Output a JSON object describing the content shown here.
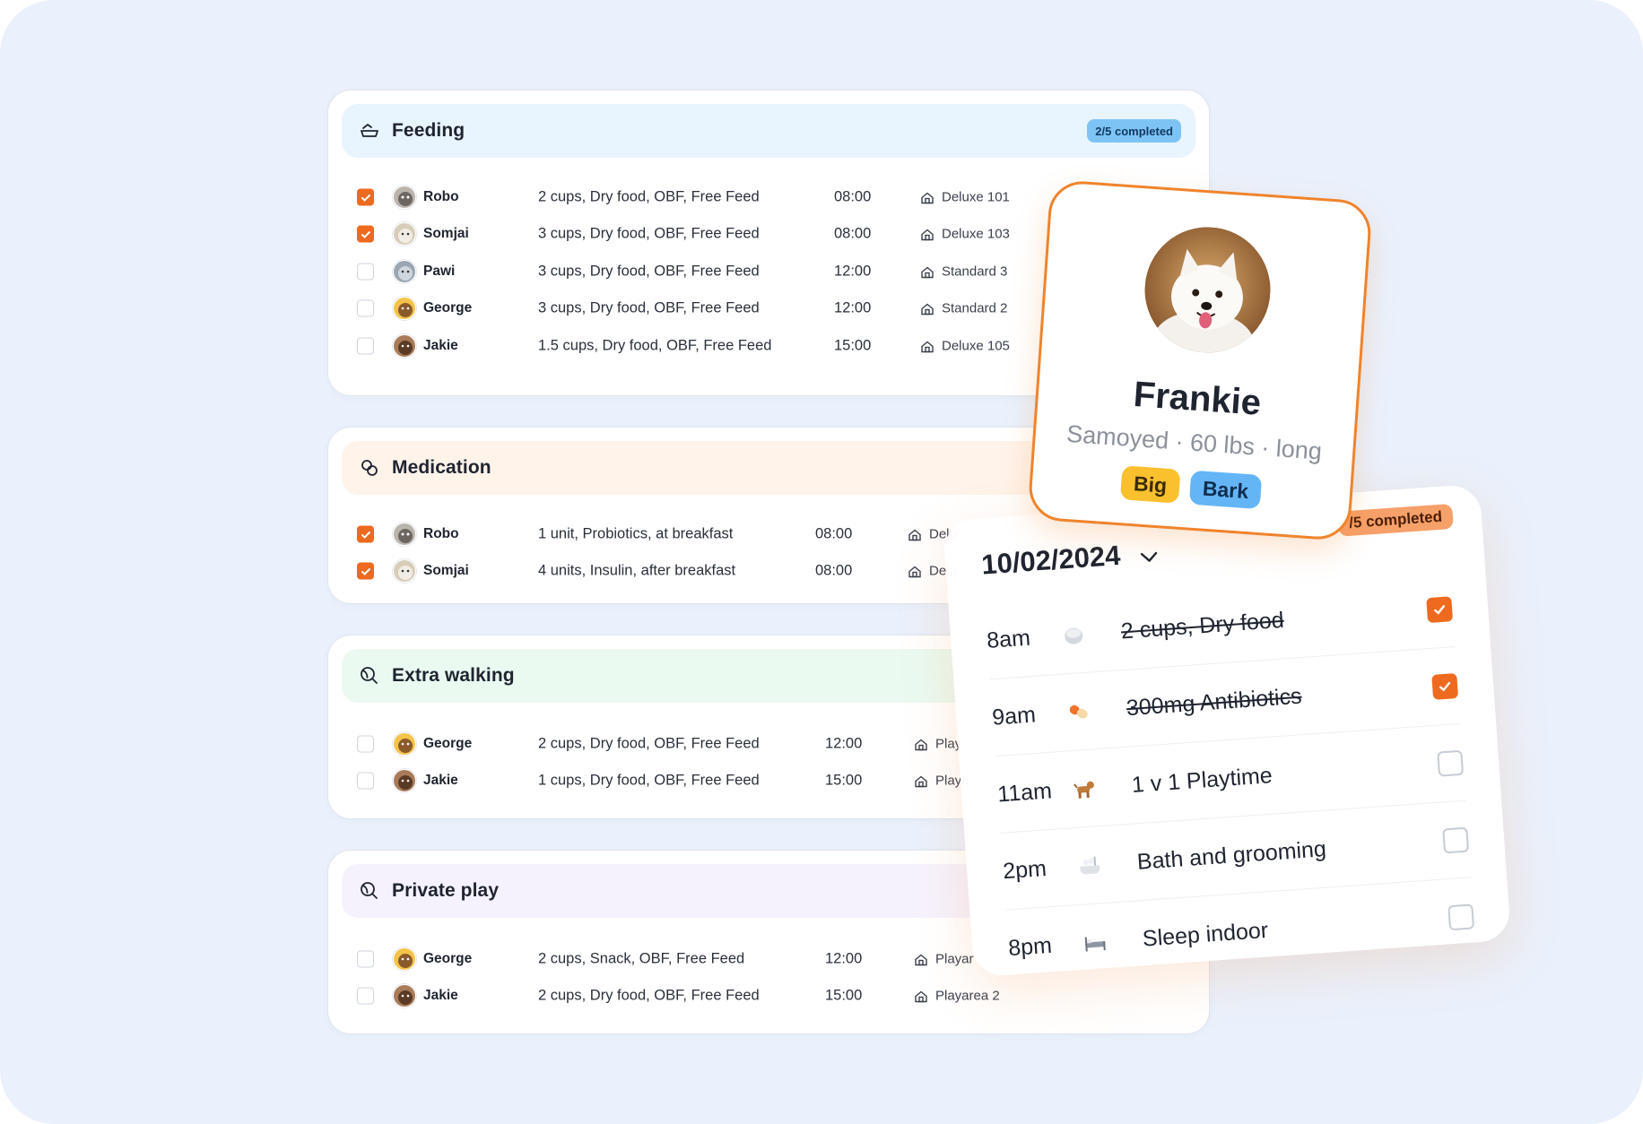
{
  "colors": {
    "accent": "#ee6a1f",
    "background": "#eaf1fc",
    "feeding": "#e8f4fe",
    "medication": "#fff3ea",
    "walking": "#eafaf1",
    "play": "#f6f2fd"
  },
  "sections": [
    {
      "title": "Feeding",
      "icon": "bowl-icon",
      "badge": "2/5 completed",
      "rows": [
        {
          "checked": true,
          "pet": "Robo",
          "detail": "2 cups, Dry food,  OBF, Free Feed",
          "time": "08:00",
          "room": "Deluxe 101"
        },
        {
          "checked": true,
          "pet": "Somjai",
          "detail": "3 cups, Dry food,  OBF, Free Feed",
          "time": "08:00",
          "room": "Deluxe 103"
        },
        {
          "checked": false,
          "pet": "Pawi",
          "detail": "3 cups, Dry food,  OBF, Free Feed",
          "time": "12:00",
          "room": "Standard 3"
        },
        {
          "checked": false,
          "pet": "George",
          "detail": "3 cups, Dry food,  OBF, Free Feed",
          "time": "12:00",
          "room": "Standard 2"
        },
        {
          "checked": false,
          "pet": "Jakie",
          "detail": "1.5 cups, Dry food,  OBF, Free Feed",
          "time": "15:00",
          "room": "Deluxe 105"
        }
      ]
    },
    {
      "title": "Medication",
      "icon": "pills-icon",
      "rows": [
        {
          "checked": true,
          "pet": "Robo",
          "detail": "1 unit, Probiotics, at breakfast",
          "time": "08:00",
          "room": "Delu"
        },
        {
          "checked": true,
          "pet": "Somjai",
          "detail": "4 units, Insulin, after breakfast",
          "time": "08:00",
          "room": "Delu"
        }
      ]
    },
    {
      "title": "Extra walking",
      "icon": "tennis-ball-icon",
      "rows": [
        {
          "checked": false,
          "pet": "George",
          "detail": "2 cups, Dry food,  OBF, Free Feed",
          "time": "12:00",
          "room": "Play"
        },
        {
          "checked": false,
          "pet": "Jakie",
          "detail": "1 cups, Dry food,  OBF, Free Feed",
          "time": "15:00",
          "room": "Playa"
        }
      ]
    },
    {
      "title": "Private play",
      "icon": "tennis-ball-icon",
      "rows": [
        {
          "checked": false,
          "pet": "George",
          "detail": "2 cups, Snack,  OBF, Free Feed",
          "time": "12:00",
          "room": "Playar"
        },
        {
          "checked": false,
          "pet": "Jakie",
          "detail": "2 cups, Dry food,  OBF, Free Feed",
          "time": "15:00",
          "room": "Playarea 2"
        }
      ]
    }
  ],
  "pet_card": {
    "name": "Frankie",
    "meta": "Samoyed · 60 lbs · long",
    "tags": [
      "Big",
      "Bark"
    ]
  },
  "schedule": {
    "date": "10/02/2024",
    "badge": "/5 completed",
    "items": [
      {
        "time": "8am",
        "icon": "bowl-icon",
        "text": "2 cups, Dry food",
        "checked": true
      },
      {
        "time": "9am",
        "icon": "pill-icon",
        "text": "300mg Antibiotics",
        "checked": true
      },
      {
        "time": "11am",
        "icon": "dog-icon",
        "text": "1 v 1 Playtime",
        "checked": false
      },
      {
        "time": "2pm",
        "icon": "bathtub-icon",
        "text": "Bath and grooming",
        "checked": false
      },
      {
        "time": "8pm",
        "icon": "bed-icon",
        "text": "Sleep indoor",
        "checked": false
      }
    ]
  }
}
